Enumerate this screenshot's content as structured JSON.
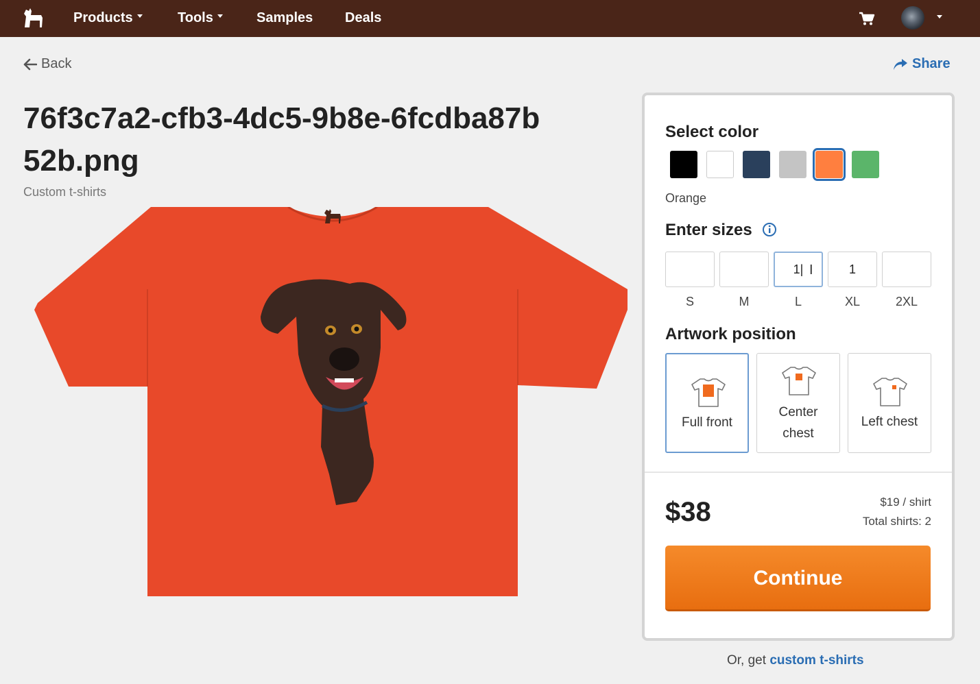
{
  "nav": {
    "products": "Products",
    "tools": "Tools",
    "samples": "Samples",
    "deals": "Deals"
  },
  "header": {
    "back": "Back",
    "share": "Share"
  },
  "design": {
    "title": "76f3c7a2-cfb3-4dc5-9b8e-6fcdba87b52b.png",
    "subtitle": "Custom t-shirts"
  },
  "panel": {
    "select_color": "Select color",
    "colors": [
      {
        "name": "black",
        "hex": "#000000"
      },
      {
        "name": "white",
        "hex": "#ffffff"
      },
      {
        "name": "navy",
        "hex": "#2a405c"
      },
      {
        "name": "gray",
        "hex": "#c4c4c4"
      },
      {
        "name": "orange",
        "hex": "#ff7f3f"
      },
      {
        "name": "green",
        "hex": "#5bb56a"
      }
    ],
    "selected_color": "Orange",
    "enter_sizes": "Enter sizes",
    "sizes": [
      {
        "label": "S",
        "value": ""
      },
      {
        "label": "M",
        "value": ""
      },
      {
        "label": "L",
        "value": "1|"
      },
      {
        "label": "XL",
        "value": "1"
      },
      {
        "label": "2XL",
        "value": ""
      }
    ],
    "artwork_position": "Artwork position",
    "positions": [
      {
        "line1": "Full front",
        "line2": ""
      },
      {
        "line1": "Center",
        "line2": "chest"
      },
      {
        "line1": "Left chest",
        "line2": ""
      }
    ],
    "price": "$38",
    "per_shirt": "$19 / shirt",
    "total_shirts": "Total shirts: 2",
    "continue": "Continue"
  },
  "footer": {
    "prefix": "Or, get",
    "link": "custom t-shirts"
  },
  "colors": {
    "nav_bg": "#4a2518",
    "accent": "#2a6db3",
    "cta": "#f07a1a",
    "shirt": "#e8492a"
  }
}
